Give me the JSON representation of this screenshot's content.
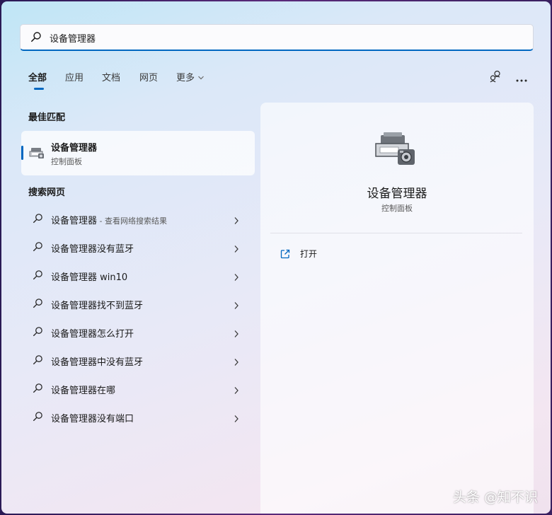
{
  "search": {
    "query": "设备管理器",
    "icon": "search-icon"
  },
  "tabs": [
    {
      "label": "全部",
      "active": true
    },
    {
      "label": "应用",
      "active": false
    },
    {
      "label": "文档",
      "active": false
    },
    {
      "label": "网页",
      "active": false
    },
    {
      "label": "更多",
      "active": false
    }
  ],
  "toolbar": {
    "account_icon": "account-switch-icon",
    "more_icon": "more-options-icon"
  },
  "best_match": {
    "section_title": "最佳匹配",
    "title": "设备管理器",
    "subtitle": "控制面板"
  },
  "web": {
    "section_title": "搜索网页",
    "items": [
      {
        "text": "设备管理器",
        "suffix": " - 查看网络搜索结果"
      },
      {
        "text": "设备管理器没有蓝牙",
        "suffix": ""
      },
      {
        "text": "设备管理器 win10",
        "suffix": ""
      },
      {
        "text": "设备管理器找不到蓝牙",
        "suffix": ""
      },
      {
        "text": "设备管理器怎么打开",
        "suffix": ""
      },
      {
        "text": "设备管理器中没有蓝牙",
        "suffix": ""
      },
      {
        "text": "设备管理器在哪",
        "suffix": ""
      },
      {
        "text": "设备管理器没有端口",
        "suffix": ""
      }
    ]
  },
  "detail": {
    "title": "设备管理器",
    "subtitle": "控制面板",
    "open_label": "打开"
  },
  "watermark": "头条 @知不识",
  "colors": {
    "accent": "#0067c0"
  }
}
